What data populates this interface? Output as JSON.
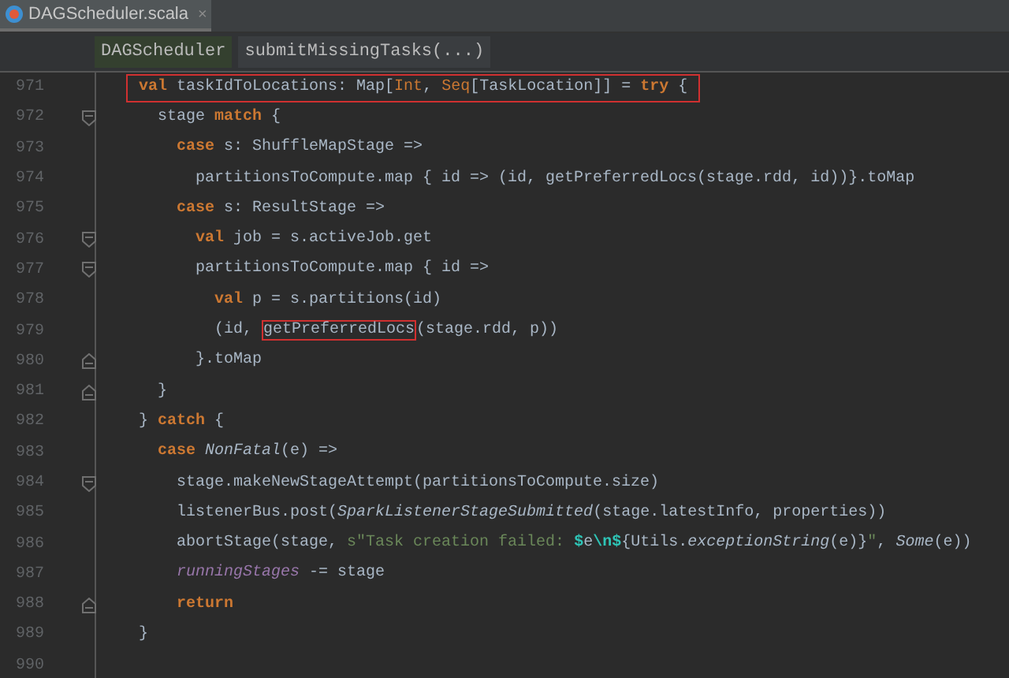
{
  "tabs": [
    {
      "label": "DAGScheduler.scala",
      "close": "×",
      "selected": true
    }
  ],
  "breadcrumbs": [
    {
      "label": "DAGScheduler"
    },
    {
      "label": "submitMissingTasks(...)"
    }
  ],
  "lines": [
    {
      "number": "971",
      "boxed": true,
      "kind": "code",
      "tokens": [
        {
          "kind": "keyword",
          "text": "val"
        },
        {
          "kind": "plain",
          "text": " taskIdToLocations: Map["
        },
        {
          "kind": "type",
          "text": "Int"
        },
        {
          "kind": "plain",
          "text": ", "
        },
        {
          "kind": "type",
          "text": "Seq"
        },
        {
          "kind": "plain",
          "text": "[TaskLocation]] = "
        },
        {
          "kind": "keyword",
          "text": "try"
        },
        {
          "kind": "plain",
          "text": " {"
        }
      ],
      "children": [
        {
          "number": "972",
          "boxed": false,
          "kind": "block-start",
          "tokens": [
            {
              "kind": "plain",
              "text": "stage "
            },
            {
              "kind": "keyword",
              "text": "match"
            },
            {
              "kind": "plain",
              "text": " {"
            }
          ],
          "children": [
            {
              "number": "973",
              "boxed": false,
              "kind": "code",
              "tokens": [
                {
                  "kind": "keyword",
                  "text": "case"
                },
                {
                  "kind": "plain",
                  "text": " s: ShuffleMapStage =>"
                }
              ],
              "children": [
                {
                  "number": "974",
                  "boxed": false,
                  "kind": "code",
                  "tokens": [
                    {
                      "kind": "plain",
                      "text": "partitionsToCompute.map { id => (id, getPreferredLocs(stage.rdd, id))}.toMap"
                    }
                  ]
                }
              ]
            },
            {
              "number": "975",
              "boxed": false,
              "kind": "code",
              "tokens": [
                {
                  "kind": "keyword",
                  "text": "case"
                },
                {
                  "kind": "plain",
                  "text": " s: ResultStage =>"
                }
              ],
              "children": [
                {
                  "number": "976",
                  "boxed": false,
                  "kind": "block-start",
                  "tokens": [
                    {
                      "kind": "keyword",
                      "text": "val"
                    },
                    {
                      "kind": "plain",
                      "text": " job = s.activeJob.get"
                    }
                  ]
                },
                {
                  "number": "977",
                  "boxed": false,
                  "kind": "block-start",
                  "tokens": [
                    {
                      "kind": "plain",
                      "text": "partitionsToCompute.map { id =>"
                    }
                  ],
                  "children": [
                    {
                      "number": "978",
                      "boxed": false,
                      "kind": "code",
                      "tokens": [
                        {
                          "kind": "keyword",
                          "text": "val"
                        },
                        {
                          "kind": "plain",
                          "text": " p = s.partitions(id)"
                        }
                      ]
                    },
                    {
                      "number": "979",
                      "boxed": false,
                      "kind": "code",
                      "tokens": [
                        {
                          "kind": "plain",
                          "text": "(id, "
                        },
                        {
                          "kind": "boxed",
                          "text": "getPreferredLocs"
                        },
                        {
                          "kind": "plain",
                          "text": "(stage.rdd, p))"
                        }
                      ]
                    }
                  ]
                },
                {
                  "number": "980",
                  "boxed": false,
                  "kind": "block-end",
                  "tokens": [
                    {
                      "kind": "plain",
                      "text": "}.toMap"
                    }
                  ]
                }
              ]
            }
          ]
        },
        {
          "number": "981",
          "boxed": false,
          "kind": "block-end",
          "tokens": [
            {
              "kind": "plain",
              "text": "}"
            }
          ]
        }
      ]
    },
    {
      "number": "982",
      "boxed": false,
      "kind": "code",
      "tokens": [
        {
          "kind": "plain",
          "text": "} "
        },
        {
          "kind": "keyword",
          "text": "catch"
        },
        {
          "kind": "plain",
          "text": " {"
        }
      ],
      "children": [
        {
          "number": "983",
          "boxed": false,
          "kind": "code",
          "tokens": [
            {
              "kind": "keyword",
              "text": "case "
            },
            {
              "kind": "italic",
              "text": "NonFatal"
            },
            {
              "kind": "plain",
              "text": "(e) =>"
            }
          ],
          "children": [
            {
              "number": "984",
              "boxed": false,
              "kind": "block-start",
              "tokens": [
                {
                  "kind": "plain",
                  "text": "stage.makeNewStageAttempt(partitionsToCompute.size)"
                }
              ]
            },
            {
              "number": "985",
              "boxed": false,
              "kind": "code",
              "tokens": [
                {
                  "kind": "plain",
                  "text": "listenerBus.post("
                },
                {
                  "kind": "italic",
                  "text": "SparkListenerStageSubmitted"
                },
                {
                  "kind": "plain",
                  "text": "(stage.latestInfo, properties))"
                }
              ]
            },
            {
              "number": "986",
              "boxed": false,
              "kind": "code",
              "tokens": [
                {
                  "kind": "plain",
                  "text": "abortStage(stage, "
                },
                {
                  "kind": "string",
                  "text": "s\"Task creation failed: "
                },
                {
                  "kind": "escape",
                  "text": "$"
                },
                {
                  "kind": "plain",
                  "text": "e"
                },
                {
                  "kind": "escape",
                  "text": "\\n$"
                },
                {
                  "kind": "plain",
                  "text": "{Utils."
                },
                {
                  "kind": "italic",
                  "text": "exceptionString"
                },
                {
                  "kind": "plain",
                  "text": "(e)}"
                },
                {
                  "kind": "string",
                  "text": "\""
                },
                {
                  "kind": "plain",
                  "text": ", "
                },
                {
                  "kind": "italic",
                  "text": "Some"
                },
                {
                  "kind": "plain",
                  "text": "(e))"
                }
              ]
            },
            {
              "number": "987",
              "boxed": false,
              "kind": "code",
              "tokens": [
                {
                  "kind": "field",
                  "text": "runningStages"
                },
                {
                  "kind": "plain",
                  "text": " -= stage"
                }
              ]
            },
            {
              "number": "988",
              "boxed": false,
              "kind": "block-end",
              "tokens": [
                {
                  "kind": "keyword",
                  "text": "return"
                }
              ]
            }
          ]
        }
      ]
    },
    {
      "number": "989",
      "boxed": false,
      "kind": "code",
      "tokens": [
        {
          "kind": "plain",
          "text": "}"
        }
      ]
    },
    {
      "number": "990",
      "boxed": false,
      "kind": "code"
    }
  ]
}
